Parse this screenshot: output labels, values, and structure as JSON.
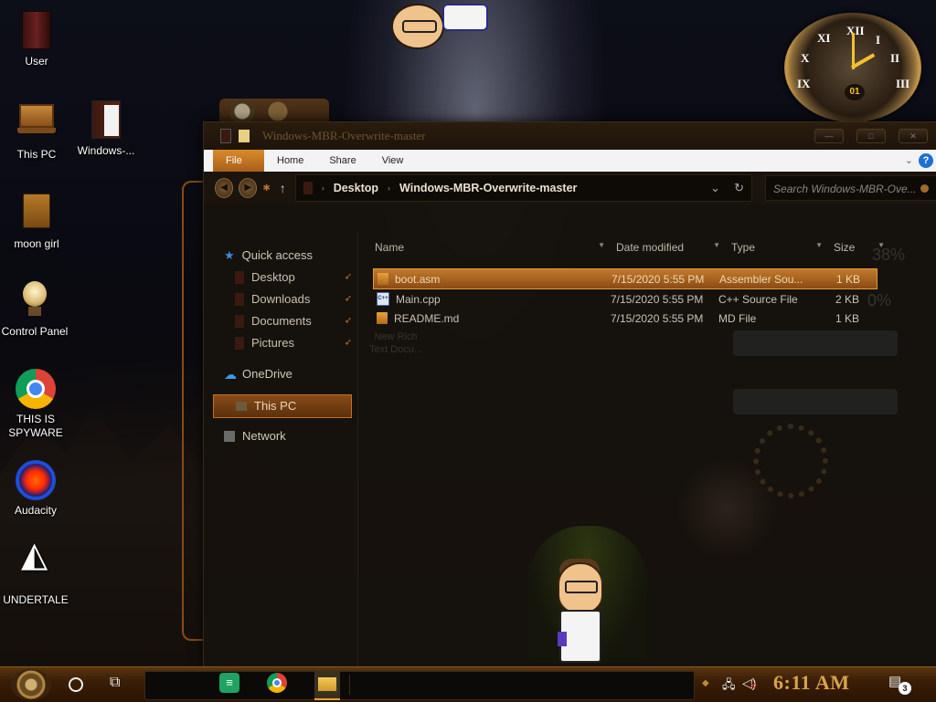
{
  "desktop": {
    "icons": [
      {
        "label": "User",
        "glyph": "folder-book-icon"
      },
      {
        "label": "This PC",
        "glyph": "this-pc-icon"
      },
      {
        "label": "Windows-...",
        "glyph": "folder-icon"
      },
      {
        "label": "moon girl",
        "glyph": "bag-icon"
      },
      {
        "label": "Control Panel",
        "glyph": "lightbulb-icon"
      },
      {
        "label": "THIS IS SPYWARE",
        "glyph": "chrome-icon"
      },
      {
        "label": "Audacity",
        "glyph": "audacity-icon"
      },
      {
        "label": "UNDERTALE",
        "glyph": "unity-icon"
      }
    ]
  },
  "clock_widget": {
    "numerals": [
      "XII",
      "I",
      "II",
      "III",
      "IX",
      "X",
      "XI"
    ],
    "center": "01"
  },
  "explorer": {
    "title": "Windows-MBR-Overwrite-master",
    "ribbon_tabs": {
      "file": "File",
      "home": "Home",
      "share": "Share",
      "view": "View"
    },
    "help": "?",
    "address": {
      "crumb1": "Desktop",
      "crumb2": "Windows-MBR-Overwrite-master"
    },
    "search_placeholder": "Search Windows-MBR-Ove...",
    "sidebar": {
      "quick_access": "Quick access",
      "items": [
        "Desktop",
        "Downloads",
        "Documents",
        "Pictures"
      ],
      "onedrive": "OneDrive",
      "this_pc": "This PC",
      "network": "Network"
    },
    "columns": {
      "name": "Name",
      "date": "Date modified",
      "type": "Type",
      "size": "Size"
    },
    "files": [
      {
        "name": "boot.asm",
        "date": "7/15/2020 5:55 PM",
        "type": "Assembler Sou...",
        "size": "1 KB"
      },
      {
        "name": "Main.cpp",
        "date": "7/15/2020 5:55 PM",
        "type": "C++ Source File",
        "size": "2 KB"
      },
      {
        "name": "README.md",
        "date": "7/15/2020 5:55 PM",
        "type": "MD File",
        "size": "1 KB"
      }
    ],
    "ghost_label": "New Rich Text Docu...",
    "ghost_pct1": "38%",
    "ghost_pct2": "0%"
  },
  "taskbar": {
    "time": "6:11 AM",
    "notification_count": "3"
  },
  "colors": {
    "accent": "#c27a2a",
    "taskbar": "#3a1e06",
    "clock_text": "#d8a24a"
  }
}
